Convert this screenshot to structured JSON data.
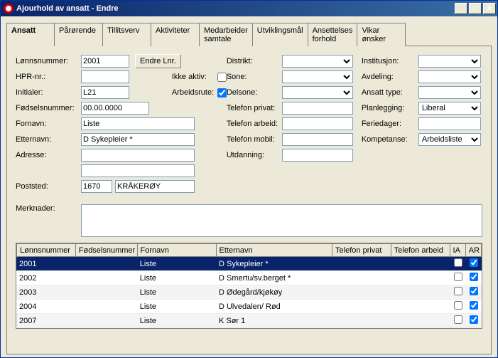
{
  "window": {
    "title": "Ajourhold av ansatt - Endre"
  },
  "tabs": [
    {
      "label": "Ansatt"
    },
    {
      "label": "Pårørende"
    },
    {
      "label": "Tillitsverv"
    },
    {
      "label": "Aktiviteter"
    },
    {
      "label": "Medarbeider\nsamtale"
    },
    {
      "label": "Utviklingsmål"
    },
    {
      "label": "Ansettelses\nforhold"
    },
    {
      "label": "Vikar\nønsker"
    }
  ],
  "labels": {
    "lonnsnummer": "Lønnsnummer:",
    "hprnr": "HPR-nr.:",
    "initialer": "Initialer:",
    "fodselsnummer": "Fødselsnummer:",
    "fornavn": "Fornavn:",
    "etternavn": "Etternavn:",
    "adresse": "Adresse:",
    "poststed": "Poststed:",
    "endre_lnr": "Endre Lnr.",
    "ikke_aktiv": "Ikke aktiv:",
    "arbeidsrute": "Arbeidsrute:",
    "distrikt": "Distrikt:",
    "sone": "Sone:",
    "delsone": "Delsone:",
    "telefon_privat": "Telefon privat:",
    "telefon_arbeid": "Telefon arbeid:",
    "telefon_mobil": "Telefon mobil:",
    "utdanning": "Utdanning:",
    "institusjon": "Institusjon:",
    "avdeling": "Avdeling:",
    "ansatt_type": "Ansatt type:",
    "planlegging": "Planlegging:",
    "feriedager": "Feriedager:",
    "kompetanse": "Kompetanse:",
    "merknader": "Merknader:"
  },
  "values": {
    "lonnsnummer": "2001",
    "hprnr": "",
    "initialer": "L21",
    "fodselsnummer": "00.00.0000",
    "fornavn": "Liste",
    "etternavn": "D Sykepleier *",
    "adresse1": "",
    "adresse2": "",
    "post_nr": "1670",
    "post_sted": "KRÅKERØY",
    "ikke_aktiv": false,
    "arbeidsrute": true,
    "distrikt": "",
    "sone": "",
    "delsone": "",
    "telefon_privat": "",
    "telefon_arbeid": "",
    "telefon_mobil": "",
    "utdanning": "",
    "institusjon": "",
    "avdeling": "",
    "ansatt_type": "",
    "planlegging": "Liberal",
    "feriedager": "",
    "kompetanse": "Arbeidsliste",
    "merknader": ""
  },
  "grid": {
    "headers": {
      "lonnsnummer": "Lønnsnummer",
      "fodselsnummer": "Fødselsnummer",
      "fornavn": "Fornavn",
      "etternavn": "Etternavn",
      "telefon_privat": "Telefon privat",
      "telefon_arbeid": "Telefon arbeid",
      "ia": "IA",
      "ar": "AR"
    },
    "rows": [
      {
        "lonnsnummer": "2001",
        "fodselsnummer": "",
        "fornavn": "Liste",
        "etternavn": "D Sykepleier *",
        "telefon_privat": "",
        "telefon_arbeid": "",
        "ia": false,
        "ar": true,
        "selected": true
      },
      {
        "lonnsnummer": "2002",
        "fodselsnummer": "",
        "fornavn": "Liste",
        "etternavn": "D Smertu/sv.berget *",
        "telefon_privat": "",
        "telefon_arbeid": "",
        "ia": false,
        "ar": true
      },
      {
        "lonnsnummer": "2003",
        "fodselsnummer": "",
        "fornavn": "Liste",
        "etternavn": "D Ødegård/kjøkøy",
        "telefon_privat": "",
        "telefon_arbeid": "",
        "ia": false,
        "ar": true
      },
      {
        "lonnsnummer": "2004",
        "fodselsnummer": "",
        "fornavn": "Liste",
        "etternavn": "D Ulvedalen/ Rød",
        "telefon_privat": "",
        "telefon_arbeid": "",
        "ia": false,
        "ar": true
      },
      {
        "lonnsnummer": "2007",
        "fodselsnummer": "",
        "fornavn": "Liste",
        "etternavn": "K Sør 1",
        "telefon_privat": "",
        "telefon_arbeid": "",
        "ia": false,
        "ar": true
      }
    ]
  }
}
